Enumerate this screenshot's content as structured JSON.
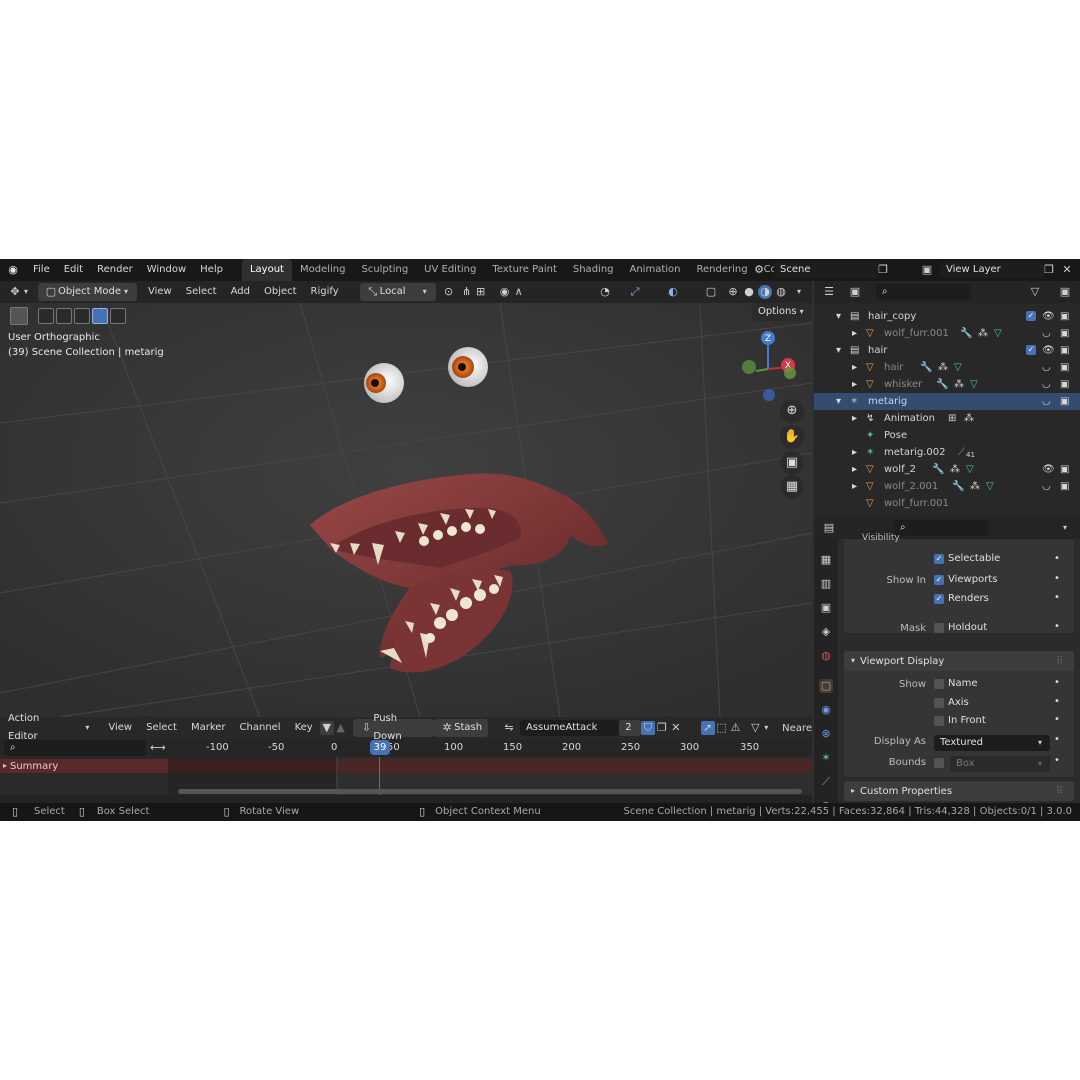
{
  "topbar": {
    "menus": [
      "File",
      "Edit",
      "Render",
      "Window",
      "Help"
    ],
    "workspaces": [
      "Layout",
      "Modeling",
      "Sculpting",
      "UV Editing",
      "Texture Paint",
      "Shading",
      "Animation",
      "Rendering",
      "Compo"
    ],
    "active_workspace": "Layout",
    "scene": "Scene",
    "view_layer": "View Layer"
  },
  "viewport_header": {
    "mode": "Object Mode",
    "menus": [
      "View",
      "Select",
      "Add",
      "Object",
      "Rigify"
    ],
    "transform_orientation": "Local",
    "options": "Options"
  },
  "viewport": {
    "view_name": "User Orthographic",
    "collection_info": "(39) Scene Collection | metarig",
    "gizmo_z": "Z",
    "gizmo_x": "X"
  },
  "outliner": {
    "rows": [
      {
        "name": "hair_copy",
        "dim": false
      },
      {
        "name": "wolf_furr.001",
        "dim": true
      },
      {
        "name": "hair",
        "dim": false
      },
      {
        "name": "hair",
        "dim": true
      },
      {
        "name": "whisker",
        "dim": true
      },
      {
        "name": "metarig",
        "dim": false
      },
      {
        "name": "Animation",
        "dim": false
      },
      {
        "name": "Pose",
        "dim": false
      },
      {
        "name": "metarig.002",
        "dim": false
      },
      {
        "name": "wolf_2",
        "dim": false
      },
      {
        "name": "wolf_2.001",
        "dim": true
      },
      {
        "name": "wolf_furr.001",
        "dim": true
      }
    ],
    "bone_count": "41"
  },
  "properties": {
    "section_visibility": "Visibility",
    "selectable": "Selectable",
    "show_in_label": "Show In",
    "viewports": "Viewports",
    "renders": "Renders",
    "mask_label": "Mask",
    "holdout": "Holdout",
    "viewport_display": "Viewport Display",
    "show_label": "Show",
    "name": "Name",
    "axis": "Axis",
    "in_front": "In Front",
    "display_as_label": "Display As",
    "display_as_value": "Textured",
    "bounds_label": "Bounds",
    "bounds_value": "Box",
    "custom_properties": "Custom Properties"
  },
  "action_editor": {
    "mode": "Action Editor",
    "menus": [
      "View",
      "Select",
      "Marker",
      "Channel",
      "Key"
    ],
    "push_down": "Push Down",
    "stash": "Stash",
    "action_name": "AssumeAttack",
    "users": "2",
    "snap": "Neare",
    "frame_labels": [
      "-100",
      "-50",
      "0",
      "50",
      "100",
      "150",
      "200",
      "250",
      "300",
      "350"
    ],
    "current_frame": "39",
    "summary": "Summary"
  },
  "statusbar": {
    "select": "Select",
    "box_select": "Box Select",
    "rotate_view": "Rotate View",
    "context_menu": "Object Context Menu",
    "stats": "Scene Collection | metarig | Verts:22,455 | Faces:32,864 | Tris:44,328 | Objects:0/1 | 3.0.0"
  },
  "colors": {
    "accent": "#4772b3",
    "selection": "#344c70",
    "frame_cursor": "#4772b3",
    "summary_row": "#5a2a2a"
  }
}
